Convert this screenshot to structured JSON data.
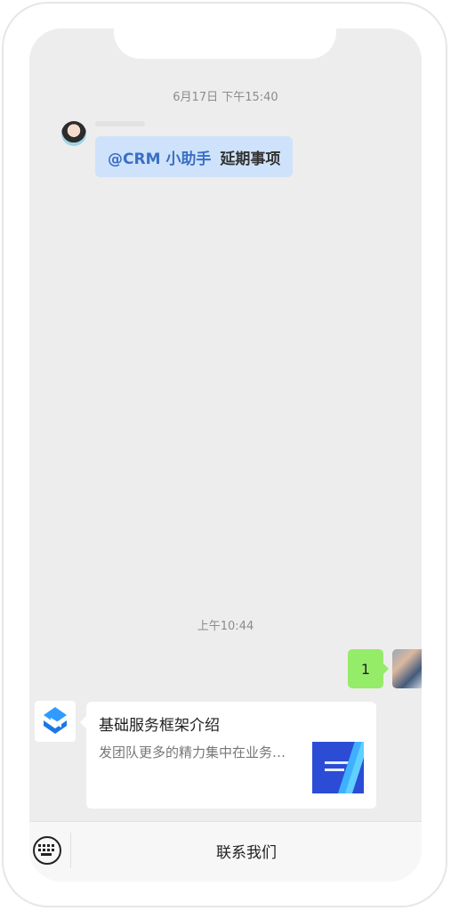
{
  "chat": {
    "timestamp_1": "6月17日 下午15:40",
    "timestamp_2": "上午10:44",
    "messages": [
      {
        "type": "text",
        "mention": "@CRM 小助手",
        "text": "延期事项"
      },
      {
        "type": "text",
        "text": "1"
      },
      {
        "type": "card",
        "title": "基础服务框架介绍",
        "description": "发团队更多的精力集中在业务…"
      }
    ]
  },
  "bottom_bar": {
    "contact_label": "联系我们"
  },
  "colors": {
    "bubble_in": "#cfe2fb",
    "bubble_out": "#95ec69",
    "mention": "#3a6fc4",
    "background": "#ededed"
  },
  "icons": [
    "keyboard-icon",
    "app-logo-icon"
  ]
}
